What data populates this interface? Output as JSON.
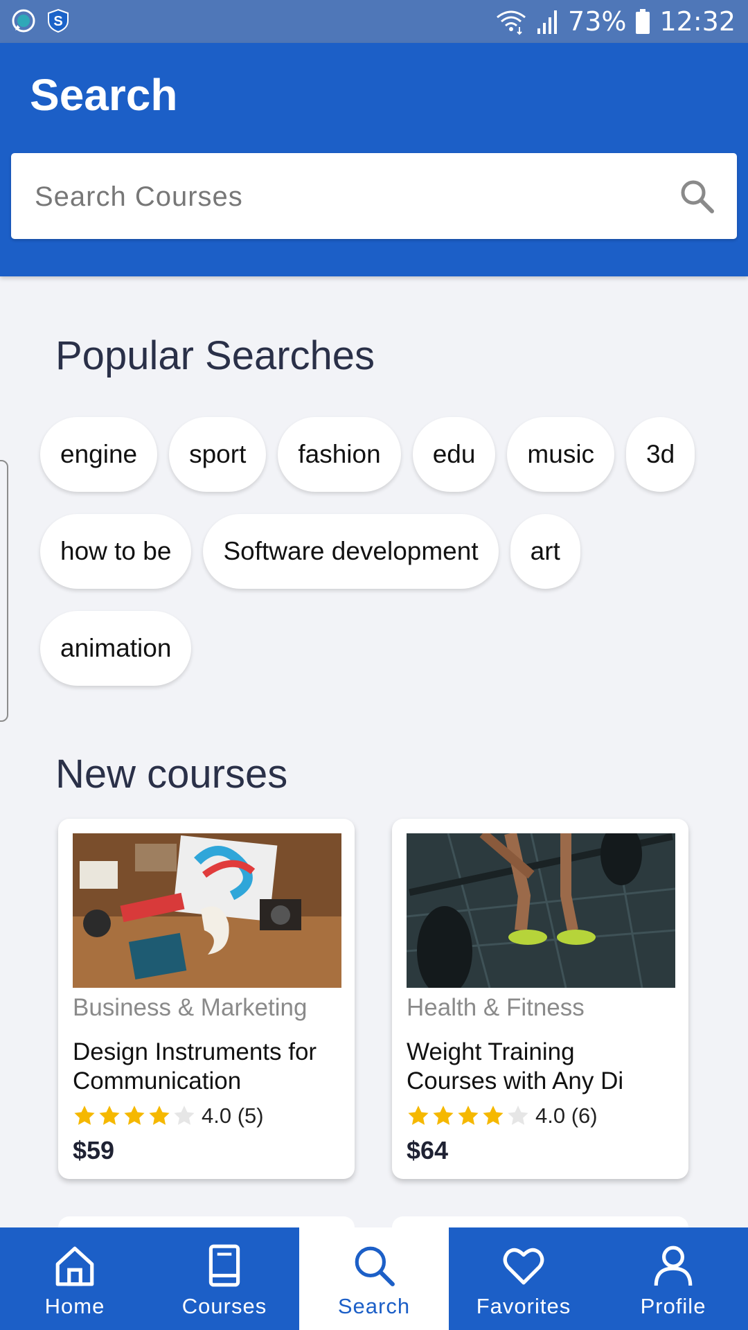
{
  "status_bar": {
    "battery": "73%",
    "time": "12:32"
  },
  "header": {
    "title": "Search"
  },
  "search": {
    "placeholder": "Search Courses"
  },
  "popular": {
    "title": "Popular Searches",
    "rows": [
      [
        "engine",
        "sport",
        "fashion",
        "edu",
        "music",
        "3d"
      ],
      [
        "how to be",
        "Software development",
        "art"
      ],
      [
        "animation"
      ]
    ]
  },
  "new_courses": {
    "title": "New courses",
    "items": [
      {
        "category": "Business & Marketing",
        "title_line1": "Design Instruments for",
        "title_line2": "Communication",
        "rating": 4.0,
        "rating_text": "4.0 (5)",
        "price": "$59"
      },
      {
        "category": "Health & Fitness",
        "title_line1": "Weight Training",
        "title_line2": "Courses with Any Di",
        "rating": 4.0,
        "rating_text": "4.0 (6)",
        "price": "$64"
      }
    ]
  },
  "nav": {
    "items": [
      {
        "label": "Home",
        "icon": "home-icon"
      },
      {
        "label": "Courses",
        "icon": "book-icon"
      },
      {
        "label": "Search",
        "icon": "search-icon",
        "active": true
      },
      {
        "label": "Favorites",
        "icon": "heart-icon"
      },
      {
        "label": "Profile",
        "icon": "user-icon"
      }
    ]
  },
  "colors": {
    "primary": "#1c5fc7",
    "status_bar": "#4f77b8",
    "background": "#f2f3f7",
    "star": "#f5b800",
    "star_empty": "#e6e6e6"
  }
}
